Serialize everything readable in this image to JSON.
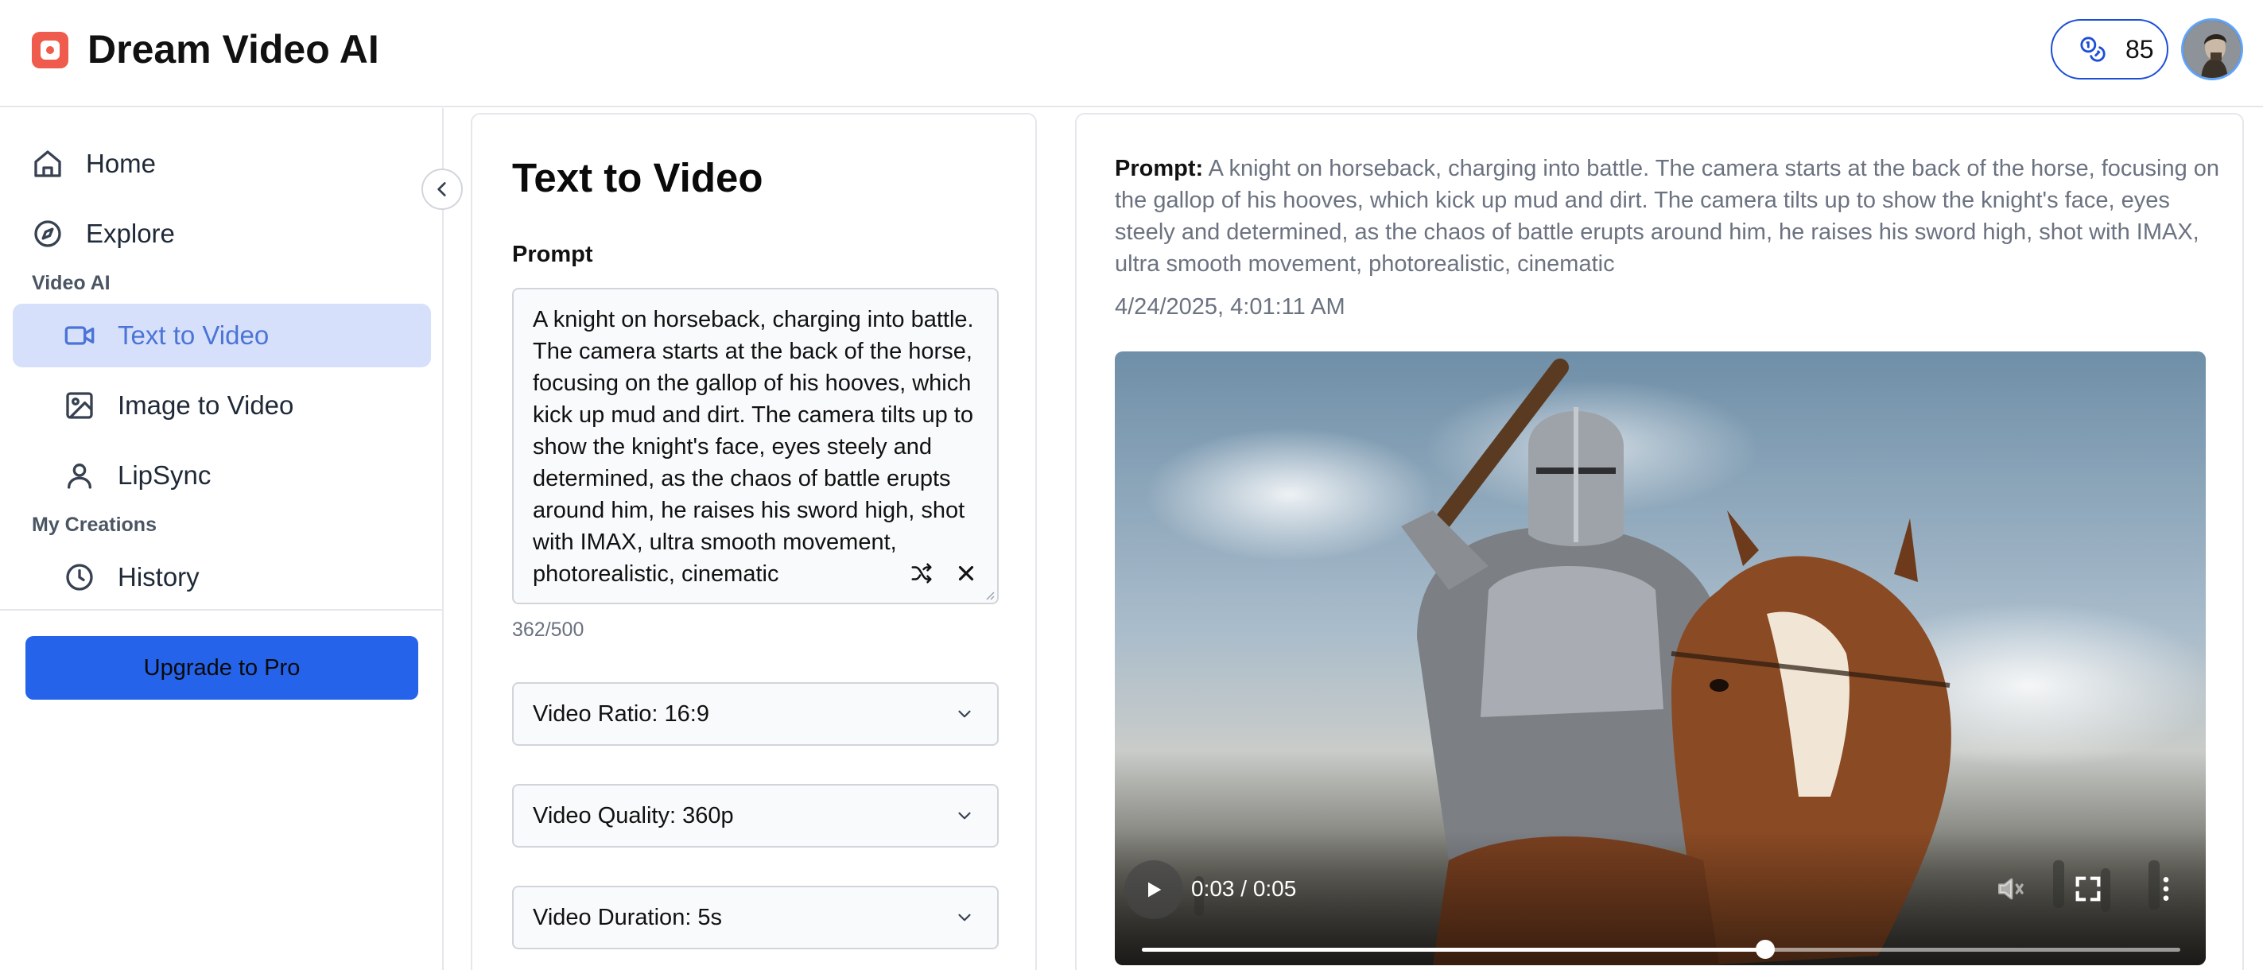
{
  "header": {
    "brand": "Dream Video AI",
    "credits": "85"
  },
  "sidebar": {
    "nav": [
      {
        "label": "Home"
      },
      {
        "label": "Explore"
      }
    ],
    "section_video_ai": "Video AI",
    "video_items": [
      {
        "label": "Text to Video",
        "active": true
      },
      {
        "label": "Image to Video"
      },
      {
        "label": "LipSync"
      }
    ],
    "section_creations": "My Creations",
    "creation_items": [
      {
        "label": "History"
      }
    ],
    "upgrade_label": "Upgrade to Pro"
  },
  "form": {
    "title": "Text to Video",
    "prompt_label": "Prompt",
    "prompt_value": "A knight on horseback, charging into battle. The camera starts at the back of the horse, focusing on the gallop of his hooves, which kick up mud and dirt. The camera tilts up to show the knight's face, eyes steely and determined, as the chaos of battle erupts around him, he raises his sword high, shot with IMAX, ultra smooth movement, photorealistic, cinematic",
    "counter": "362/500",
    "ratio": "Video Ratio: 16:9",
    "quality": "Video Quality: 360p",
    "duration": "Video Duration: 5s"
  },
  "result": {
    "prompt_key": "Prompt:",
    "prompt_text": "A knight on horseback, charging into battle. The camera starts at the back of the horse, focusing on the gallop of his hooves, which kick up mud and dirt. The camera tilts up to show the knight's face, eyes steely and determined, as the chaos of battle erupts around him, he raises his sword high, shot with IMAX, ultra smooth movement, photorealistic, cinematic",
    "timestamp": "4/24/2025, 4:01:11 AM",
    "video_time": "0:03 / 0:05",
    "progress_fraction": 0.6
  },
  "colors": {
    "accent": "#2563eb",
    "active_bg": "#d6e0fb",
    "active_text": "#4b74d6",
    "logo": "#ef5b4c"
  },
  "icons": {
    "logo": "video-logo-icon",
    "credits": "coins-icon",
    "home": "home-icon",
    "explore": "compass-icon",
    "text_to_video": "video-camera-icon",
    "image_to_video": "image-icon",
    "lipsync": "user-icon",
    "history": "clock-icon",
    "collapse": "chevron-left-icon",
    "shuffle": "shuffle-icon",
    "clear": "close-icon",
    "dropdown": "chevron-down-icon",
    "play": "play-icon",
    "mute": "volume-muted-icon",
    "fullscreen": "fullscreen-icon",
    "more": "more-vertical-icon"
  }
}
